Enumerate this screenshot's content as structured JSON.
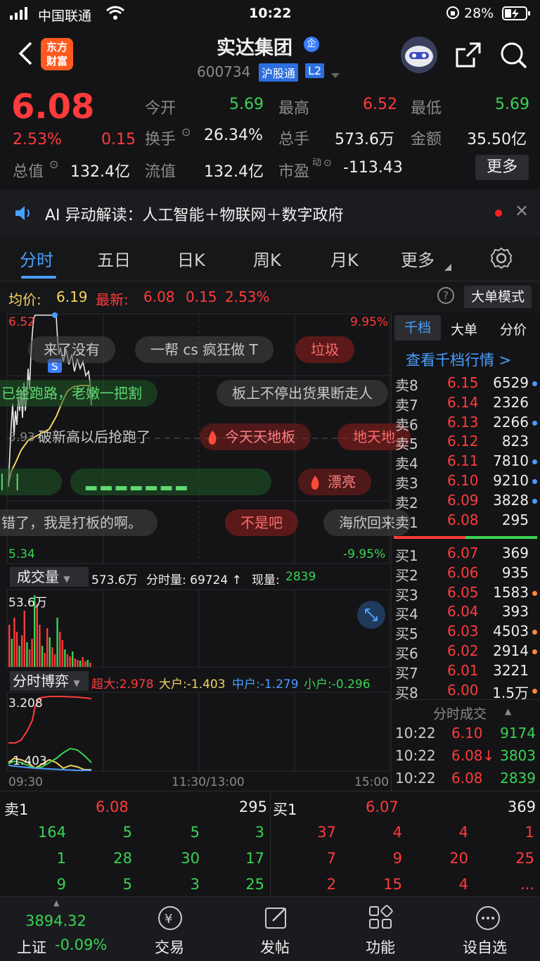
{
  "status": {
    "carrier": "中国联通",
    "time": "10:22",
    "battery": "28%"
  },
  "header": {
    "logo_line1": "东方",
    "logo_line2": "财富",
    "stock_name": "实达集团",
    "badge": "企",
    "code": "600734",
    "market": "沪股通",
    "level": "L2"
  },
  "quote": {
    "price": "6.08",
    "pct": "2.53%",
    "chg": "0.15",
    "open_label": "今开",
    "open": "5.69",
    "high_label": "最高",
    "high": "6.52",
    "low_label": "最低",
    "low": "5.69",
    "turnover_label": "换手",
    "turnover": "26.34%",
    "volume_label": "总手",
    "volume": "573.6万",
    "amount_label": "金额",
    "amount": "35.50亿",
    "mktcap_label": "总值",
    "mktcap": "132.4亿",
    "float_label": "流值",
    "float": "132.4亿",
    "pe_label": "市盈",
    "pe_sup": "动",
    "pe": "-113.43",
    "more": "更多"
  },
  "ai": {
    "text": "AI 异动解读：人工智能＋物联网＋数字政府"
  },
  "tabs": [
    "分时",
    "五日",
    "日K",
    "周K",
    "月K",
    "更多"
  ],
  "chartbar": {
    "avg_label": "均价:",
    "avg": "6.19",
    "last_label": "最新:",
    "last": "6.08",
    "chg": "0.15",
    "pct": "2.53%",
    "mode": "大单模式"
  },
  "chart": {
    "top_price": "6.52",
    "top_pct": "9.95%",
    "mid_price": "5.93",
    "bot_price": "5.34",
    "bot_pct": "-9.95%",
    "time_start": "09:30",
    "time_mid": "11:30/13:00",
    "time_end": "15:00",
    "vol_label": "成交量",
    "vol_total": "573.6万",
    "vol_tick": "分时量: 69724 ↑",
    "vol_now_label": "现量:",
    "vol_now": "2839",
    "vol_max": "53.6万",
    "game_label": "分时博弈",
    "super": "超大:2.978",
    "big": "大户:-1.403",
    "mid": "中户:-1.279",
    "small": "小户:-0.296",
    "game_top": "3.208",
    "game_bot": "-1.403"
  },
  "danmu": [
    "来了没有",
    "一帮 cs 疯狂做 T",
    "垃圾",
    "已经跑路，老嫩一把割",
    "板上不停出货果断走人",
    "破新高以后抢跑了",
    "今天天地板",
    "地天地",
    "漂亮",
    "错了，我是打板的啊。",
    "不是吧",
    "海欣回来"
  ],
  "orderbook": {
    "tabs": [
      "千档",
      "大单",
      "分价"
    ],
    "link": "查看千档行情 >",
    "asks": [
      {
        "label": "卖8",
        "price": "6.15",
        "vol": "6529"
      },
      {
        "label": "卖7",
        "price": "6.14",
        "vol": "2326"
      },
      {
        "label": "卖6",
        "price": "6.13",
        "vol": "2266"
      },
      {
        "label": "卖5",
        "price": "6.12",
        "vol": "823"
      },
      {
        "label": "卖4",
        "price": "6.11",
        "vol": "7810"
      },
      {
        "label": "卖3",
        "price": "6.10",
        "vol": "9210"
      },
      {
        "label": "卖2",
        "price": "6.09",
        "vol": "3828"
      },
      {
        "label": "卖1",
        "price": "6.08",
        "vol": "295"
      }
    ],
    "bids": [
      {
        "label": "买1",
        "price": "6.07",
        "vol": "369"
      },
      {
        "label": "买2",
        "price": "6.06",
        "vol": "935"
      },
      {
        "label": "买3",
        "price": "6.05",
        "vol": "1583"
      },
      {
        "label": "买4",
        "price": "6.04",
        "vol": "393"
      },
      {
        "label": "买5",
        "price": "6.03",
        "vol": "4503"
      },
      {
        "label": "买6",
        "price": "6.02",
        "vol": "2914"
      },
      {
        "label": "买7",
        "price": "6.01",
        "vol": "3221"
      },
      {
        "label": "买8",
        "price": "6.00",
        "vol": "1.5万"
      }
    ],
    "ticks_title": "分时成交",
    "ticks": [
      {
        "time": "10:22",
        "price": "6.10",
        "vol": "9174"
      },
      {
        "time": "10:22",
        "price": "6.08↓",
        "vol": "3803"
      },
      {
        "time": "10:22",
        "price": "6.08",
        "vol": "2839"
      }
    ]
  },
  "queue": {
    "ask_label": "卖1",
    "ask_price": "6.08",
    "ask_vol": "295",
    "bid_label": "买1",
    "bid_price": "6.07",
    "bid_vol": "369",
    "ask_rows": [
      [
        "164",
        "5",
        "5",
        "3"
      ],
      [
        "1",
        "28",
        "30",
        "17"
      ],
      [
        "9",
        "5",
        "3",
        "25"
      ]
    ],
    "bid_rows": [
      [
        "37",
        "4",
        "4",
        "1"
      ],
      [
        "7",
        "9",
        "20",
        "25"
      ],
      [
        "2",
        "15",
        "4",
        "..."
      ]
    ]
  },
  "nav": {
    "index_value": "3894.32",
    "index_name": "上证",
    "index_pct": "-0.09%",
    "items": [
      "交易",
      "发帖",
      "功能",
      "设自选"
    ]
  }
}
